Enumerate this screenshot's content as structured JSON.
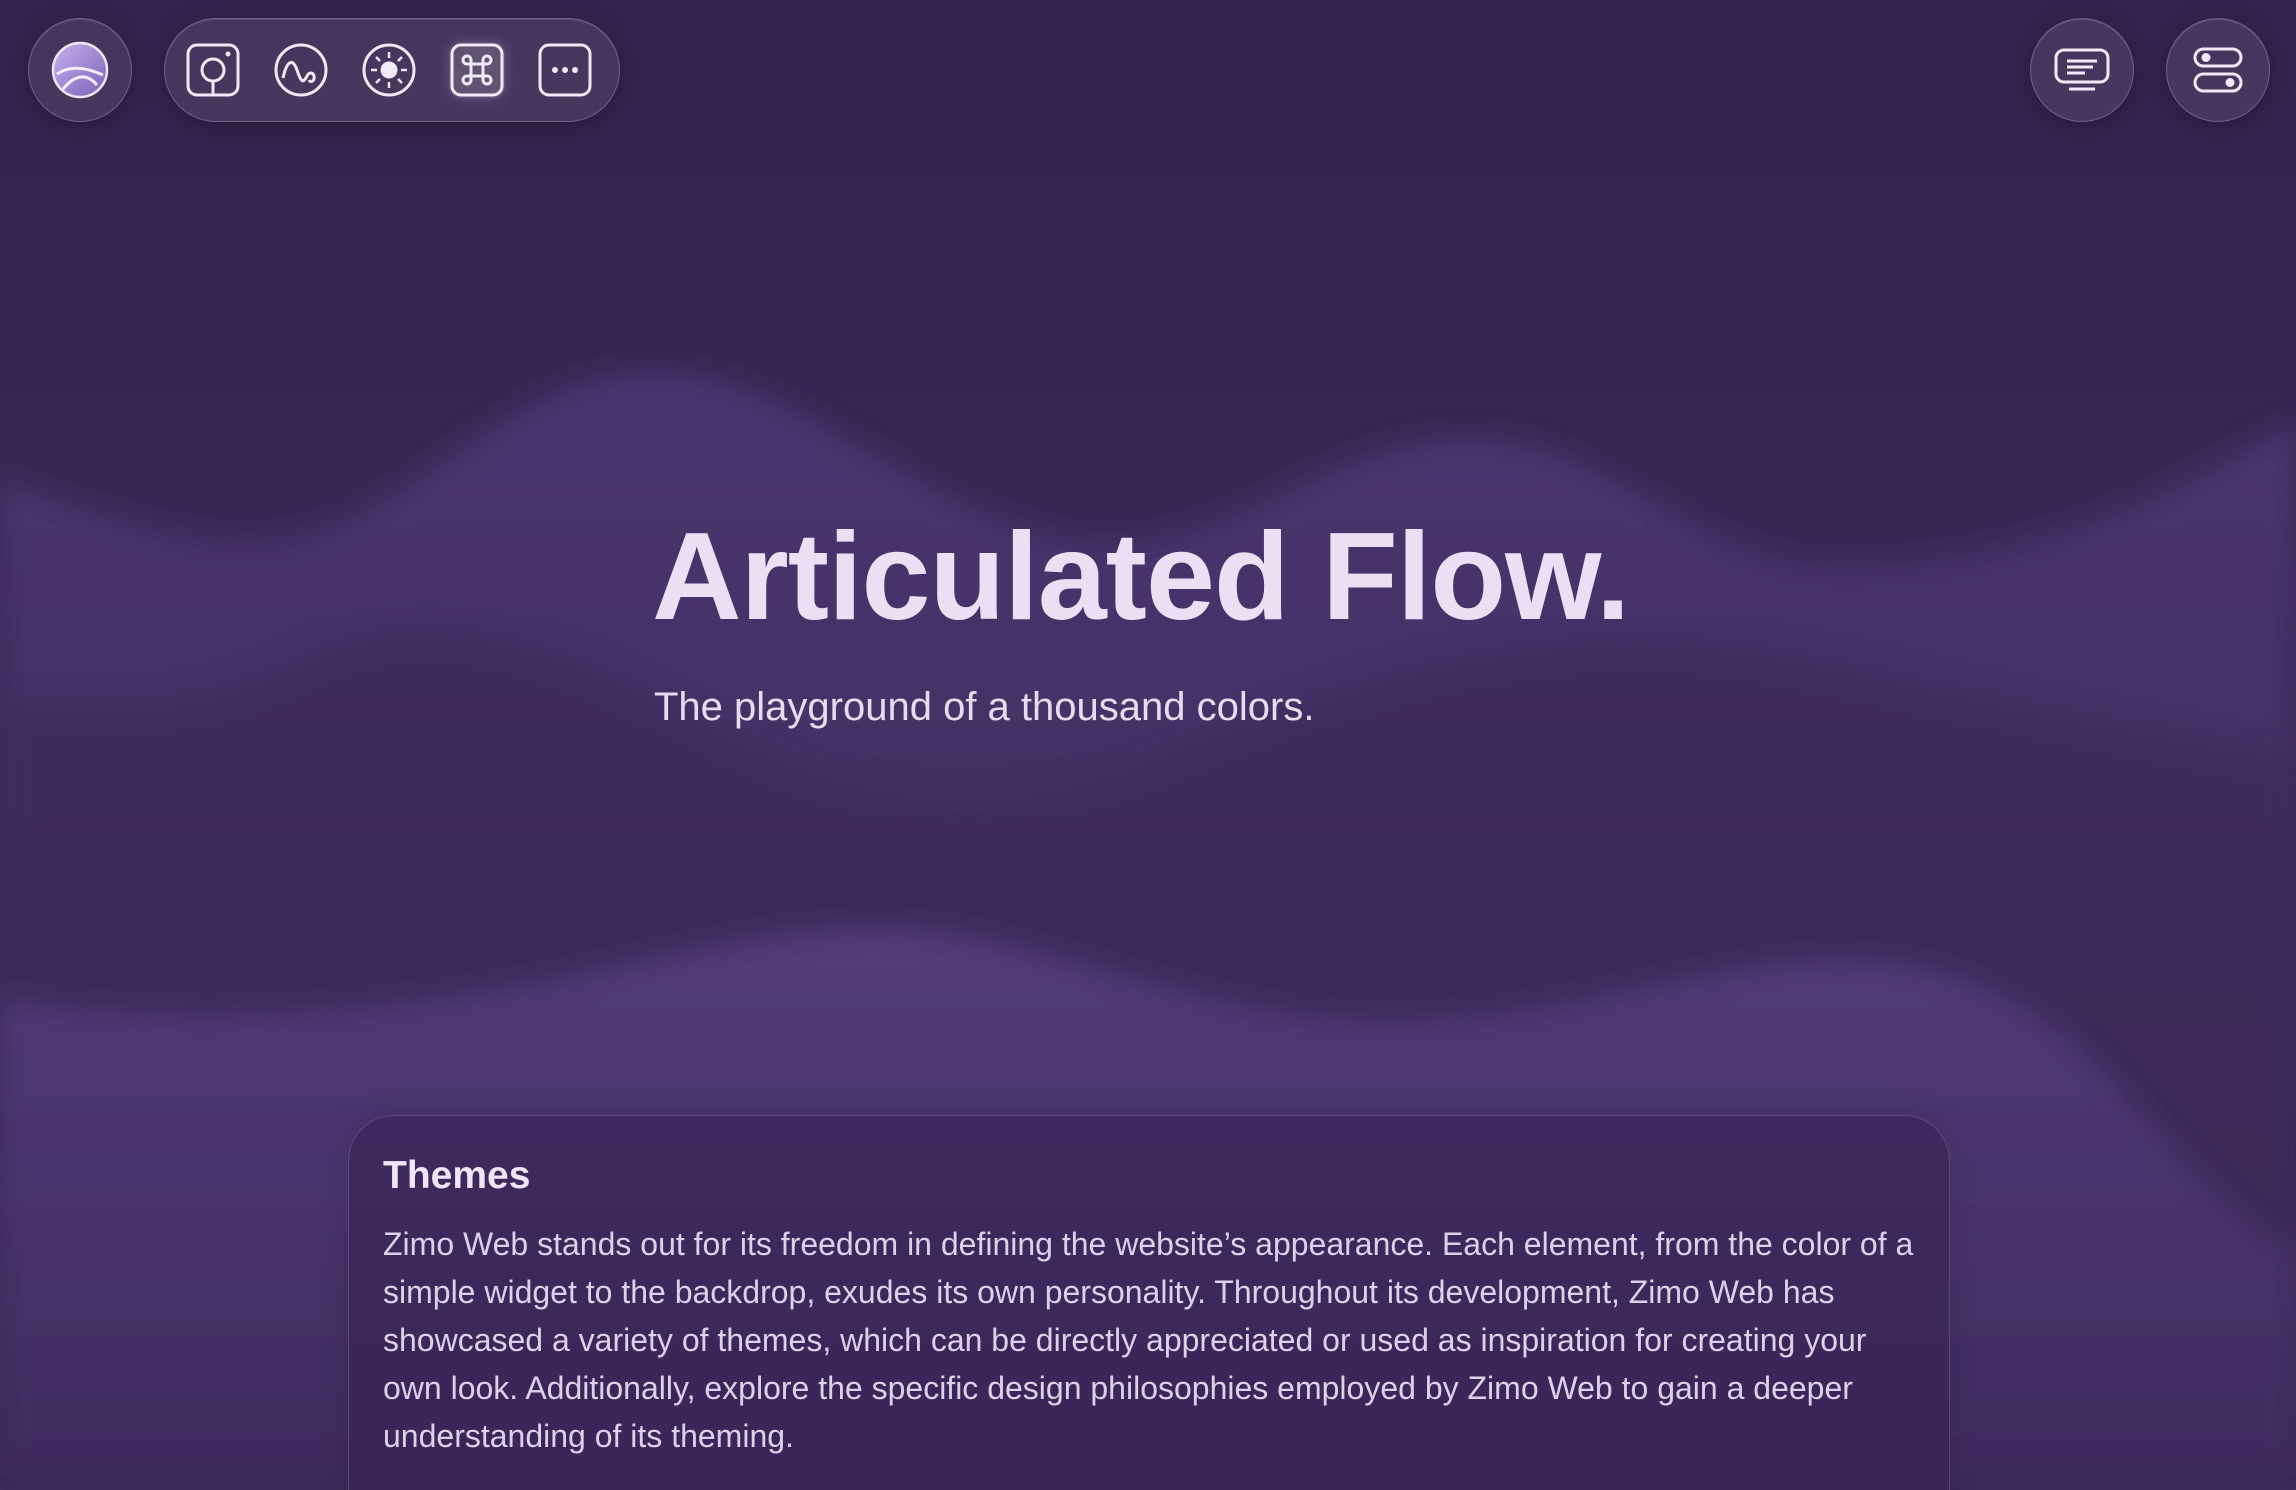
{
  "header": {
    "logo_icon": "zimo-logo-icon",
    "toolbar": [
      {
        "icon": "camera-frame-icon",
        "active": false
      },
      {
        "icon": "wave-icon",
        "active": false
      },
      {
        "icon": "sun-icon",
        "active": false
      },
      {
        "icon": "command-icon",
        "active": true
      },
      {
        "icon": "more-icon",
        "active": false
      }
    ],
    "right_buttons": [
      {
        "icon": "message-screen-icon"
      },
      {
        "icon": "toggles-icon"
      }
    ]
  },
  "hero": {
    "title": "Articulated Flow.",
    "subtitle": "The playground of a thousand colors."
  },
  "card": {
    "title": "Themes",
    "body": "Zimo Web stands out for its freedom in defining the website’s appearance. Each element, from the color of a simple widget to the backdrop, exudes its own personality. Throughout its development, Zimo Web has showcased a variety of themes, which can be directly appreciated or used as inspiration for creating your own look. Additionally, explore the specific design philosophies employed by Zimo Web to gain a deeper understanding of its theming."
  },
  "colors": {
    "background": "#35254f",
    "wave": "#4b3670",
    "text": "#ebdff4"
  }
}
